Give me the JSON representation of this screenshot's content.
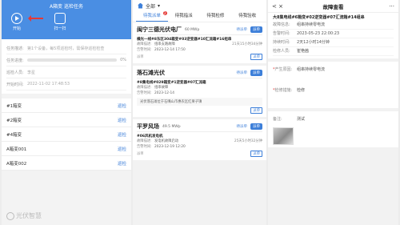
{
  "phone1": {
    "title": "A箱变 巡检任务",
    "start_label": "开始",
    "scan_label": "扫一扫",
    "info": [
      {
        "key": "任务描述:",
        "value": "第1个设备，每5项巡检时，需保存巡检检查"
      },
      {
        "key": "任务进度:",
        "value": "0%"
      },
      {
        "key": "巡检人员:",
        "value": "李星"
      },
      {
        "key": "开始时间:",
        "value": "2022-11-02 17:48:53"
      }
    ],
    "items": [
      {
        "name": "#1箱变",
        "action": "巡检"
      },
      {
        "name": "#2箱变",
        "action": "巡检"
      },
      {
        "name": "#4箱变",
        "action": "巡检"
      },
      {
        "name": "A箱变001",
        "action": "巡检"
      },
      {
        "name": "A箱变002",
        "action": "巡检"
      }
    ],
    "watermark": "光伏智慧"
  },
  "phone2": {
    "filter": "全部",
    "tabs": [
      {
        "label": "待我派单",
        "badge": "2"
      },
      {
        "label": "待我指派",
        "badge": ""
      },
      {
        "label": "待我检修",
        "badge": ""
      },
      {
        "label": "待我验收",
        "badge": ""
      }
    ],
    "stations": [
      {
        "name": "闽宁三德光伏电厂",
        "capacity": "60 MWp",
        "badge": "待派单",
        "button": "派单",
        "tickets": [
          {
            "title": "横光一线#8东区304箱变#03逆变器#10汇流箱#16组串",
            "lines": [
              {
                "key": "故障描述:",
                "value": "组串支路故障"
              },
              {
                "key": "告警时间:",
                "value": "2023-12-14 17:50"
              }
            ],
            "elapsed": "21天15小时34分钟",
            "foot": "派单",
            "action": "派单"
          }
        ]
      },
      {
        "name": "落石滩光伏",
        "capacity": "",
        "badge": "待派单",
        "button": "派单",
        "tickets": [
          {
            "title": "#8集电线#029箱变#1逆变器#07汇流箱",
            "lines": [
              {
                "key": "故障描述:",
                "value": "组串故障"
              },
              {
                "key": "告警时间:",
                "value": "2023-12-14"
              }
            ],
            "elapsed": "",
            "foot": "",
            "action": "派单",
            "notice": "光伏落石滩位于石嘴山市惠农区红果子镇"
          }
        ]
      },
      {
        "name": "平罗风场",
        "capacity": "49.5 MWp",
        "badge": "待派单",
        "button": "派单",
        "tickets": [
          {
            "title": "#06风机发电机",
            "lines": [
              {
                "key": "故障描述:",
                "value": "发电机故障启动"
              },
              {
                "key": "告警时间:",
                "value": "2023-12-19 12:20"
              }
            ],
            "elapsed": "25天5小时32分钟",
            "foot": "派单",
            "action": "派单"
          }
        ]
      }
    ]
  },
  "phone3": {
    "back": "<",
    "close": "×",
    "title": "故障查看",
    "more": "···",
    "ticket": "大8集电线#6箱变#02逆变器#07汇流箱#14组串",
    "lines": [
      {
        "key": "故障信息:",
        "value": "组串持续零电流"
      },
      {
        "key": "告警时间:",
        "value": "2023-05-23 22:00:23"
      },
      {
        "key": "持续时间:",
        "value": "2天12小时14分钟"
      },
      {
        "key": "检修人员:",
        "value": "崔艳茜"
      }
    ],
    "cause": {
      "key": "产生原因:",
      "value": "组串持续零电流"
    },
    "overhaul": {
      "key": "检修措施:",
      "value": "检修"
    },
    "remark": {
      "key": "备注:",
      "value": "测试"
    }
  }
}
